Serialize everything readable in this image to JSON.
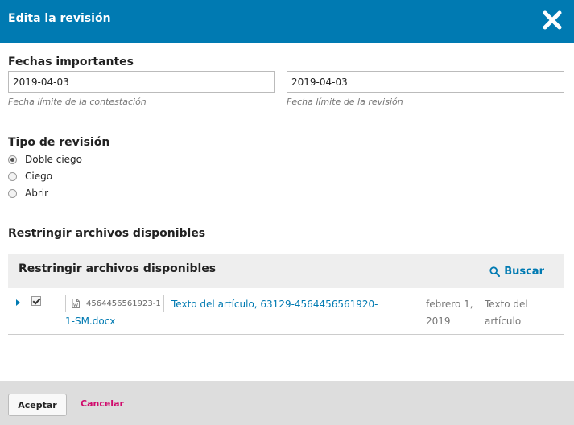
{
  "dialog": {
    "title": "Edita la revisión"
  },
  "dates": {
    "heading": "Fechas importantes",
    "response_due": {
      "value": "2019-04-03",
      "hint": "Fecha límite de la contestación"
    },
    "review_due": {
      "value": "2019-04-03",
      "hint": "Fecha límite de la revisión"
    }
  },
  "review_type": {
    "heading": "Tipo de revisión",
    "options": [
      {
        "label": "Doble ciego",
        "checked": true
      },
      {
        "label": "Ciego",
        "checked": false
      },
      {
        "label": "Abrir",
        "checked": false
      }
    ]
  },
  "restrict": {
    "heading": "Restringir archivos disponibles",
    "panel_title": "Restringir archivos disponibles",
    "search_label": "Buscar",
    "files": [
      {
        "id": "4564456561923-1",
        "name": "Texto del artículo, 63129-4564456561920-1-SM.docx",
        "date": "febrero 1, 2019",
        "type": "Texto del artículo",
        "checked": true
      }
    ]
  },
  "footer": {
    "accept_label": "Aceptar",
    "cancel_label": "Cancelar"
  },
  "colors": {
    "header": "#007ab2",
    "link": "#007ab2",
    "cancel": "#d00a6c",
    "footer": "#dddddd"
  }
}
